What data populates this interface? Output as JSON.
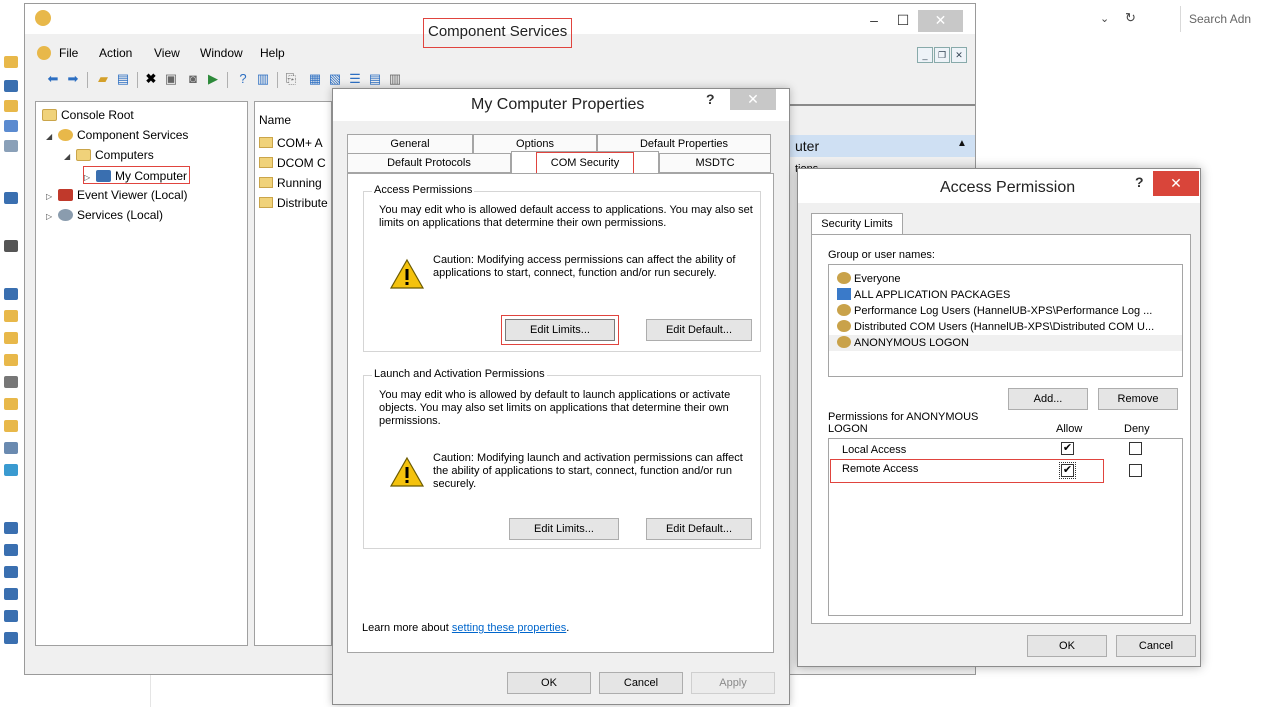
{
  "background": {
    "search_placeholder": "Search Adn"
  },
  "mmc": {
    "title": "Component Services",
    "menu": [
      "File",
      "Action",
      "View",
      "Window",
      "Help"
    ],
    "tree": {
      "root": "Console Root",
      "component_services": "Component Services",
      "computers": "Computers",
      "my_computer": "My Computer",
      "event_viewer": "Event Viewer (Local)",
      "services": "Services (Local)"
    },
    "list": {
      "header": "Name",
      "items": [
        "COM+ A",
        "DCOM C",
        "Running",
        "Distribute"
      ]
    },
    "actions_title": "uter",
    "actions_subitem": "tions"
  },
  "props": {
    "title": "My Computer Properties",
    "help": "?",
    "close": "✕",
    "tabs_row1": [
      "General",
      "Options",
      "Default Properties"
    ],
    "tabs_row2": [
      "Default Protocols",
      "COM Security",
      "MSDTC"
    ],
    "access": {
      "title": "Access Permissions",
      "text": "You may edit who is allowed default access to applications. You may also set limits on applications that determine their own permissions.",
      "caution": "Caution: Modifying access permissions can affect the ability of applications to start, connect, function and/or run securely.",
      "edit_limits": "Edit Limits...",
      "edit_default": "Edit Default..."
    },
    "launch": {
      "title": "Launch and Activation Permissions",
      "text": "You may edit who is allowed by default to launch applications or activate objects. You may also set limits on applications that determine their own permissions.",
      "caution": "Caution: Modifying launch and activation permissions can affect the ability of applications to start, connect, function and/or run securely.",
      "edit_limits": "Edit Limits...",
      "edit_default": "Edit Default..."
    },
    "learn_prefix": "Learn more about ",
    "learn_link": "setting these properties",
    "learn_suffix": ".",
    "ok": "OK",
    "cancel": "Cancel",
    "apply": "Apply"
  },
  "access_permission": {
    "title": "Access Permission",
    "help": "?",
    "close": "✕",
    "tab": "Security Limits",
    "group_label": "Group or user names:",
    "users": [
      "Everyone",
      "ALL APPLICATION PACKAGES",
      "Performance Log Users (HannelUB-XPS\\Performance Log ...",
      "Distributed COM Users (HannelUB-XPS\\Distributed COM U...",
      "ANONYMOUS LOGON"
    ],
    "add": "Add...",
    "remove": "Remove",
    "perm_label": "Permissions for ANONYMOUS LOGON",
    "allow": "Allow",
    "deny": "Deny",
    "permissions": [
      {
        "name": "Local Access",
        "allow": true,
        "deny": false
      },
      {
        "name": "Remote Access",
        "allow": true,
        "deny": false
      }
    ],
    "ok": "OK",
    "cancel": "Cancel"
  }
}
